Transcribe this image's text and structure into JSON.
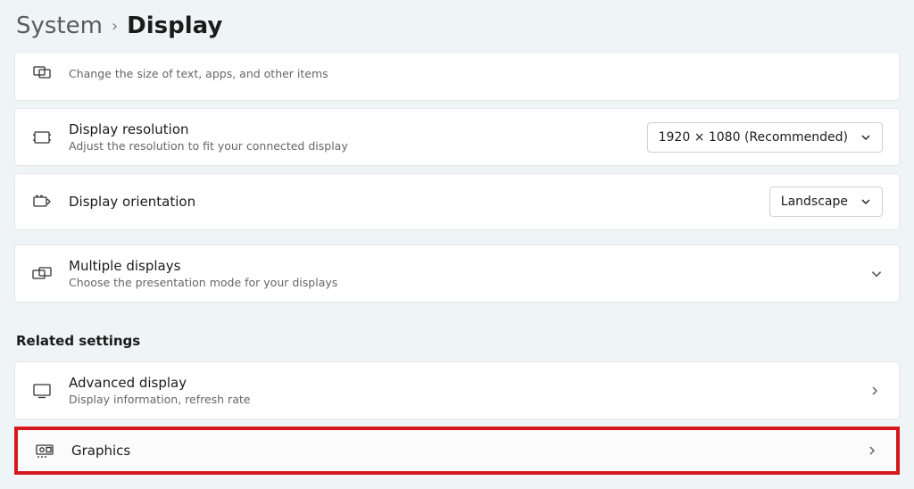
{
  "breadcrumb": {
    "parent": "System",
    "separator": "›",
    "current": "Display"
  },
  "rows": {
    "scale": {
      "subtitle": "Change the size of text, apps, and other items"
    },
    "resolution": {
      "title": "Display resolution",
      "subtitle": "Adjust the resolution to fit your connected display",
      "value": "1920 × 1080 (Recommended)"
    },
    "orientation": {
      "title": "Display orientation",
      "value": "Landscape"
    },
    "multiple": {
      "title": "Multiple displays",
      "subtitle": "Choose the presentation mode for your displays"
    }
  },
  "sections": {
    "related": "Related settings"
  },
  "related": {
    "advanced": {
      "title": "Advanced display",
      "subtitle": "Display information, refresh rate"
    },
    "graphics": {
      "title": "Graphics"
    }
  }
}
